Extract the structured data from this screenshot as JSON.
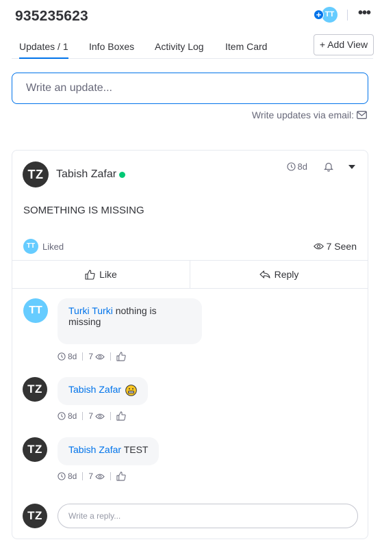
{
  "header": {
    "item_id": "935235623",
    "subscriber_initials": "TT",
    "more_label": "•••"
  },
  "tabs": [
    {
      "label": "Updates / 1",
      "active": true
    },
    {
      "label": "Info Boxes",
      "active": false
    },
    {
      "label": "Activity Log",
      "active": false
    },
    {
      "label": "Item Card",
      "active": false
    }
  ],
  "add_view_label": "+ Add View",
  "update_input": {
    "placeholder": "Write an update..."
  },
  "email_link_label": "Write updates via email:",
  "post": {
    "author_initials": "TZ",
    "author": "Tabish Zafar",
    "time": "8d",
    "body": "SOMETHING IS MISSING",
    "liked_by_initials": "TT",
    "liked_label": "Liked",
    "seen_label": "7 Seen",
    "like_label": "Like",
    "reply_label": "Reply"
  },
  "replies": [
    {
      "initials": "TT",
      "author": "Turki Turki",
      "text": "nothing is missing",
      "time": "8d",
      "views": "7",
      "emoji": ""
    },
    {
      "initials": "TZ",
      "author": "Tabish Zafar",
      "text": "",
      "time": "8d",
      "views": "7",
      "emoji": "grimacing-emoji"
    },
    {
      "initials": "TZ",
      "author": "Tabish Zafar",
      "text": "TEST",
      "time": "8d",
      "views": "7",
      "emoji": ""
    }
  ],
  "reply_input": {
    "initials": "TZ",
    "placeholder": "Write a reply..."
  },
  "colors": {
    "accent": "#0073ea",
    "online": "#00c875",
    "avatar_tt": "#66ccff",
    "avatar_tz": "#333333"
  }
}
